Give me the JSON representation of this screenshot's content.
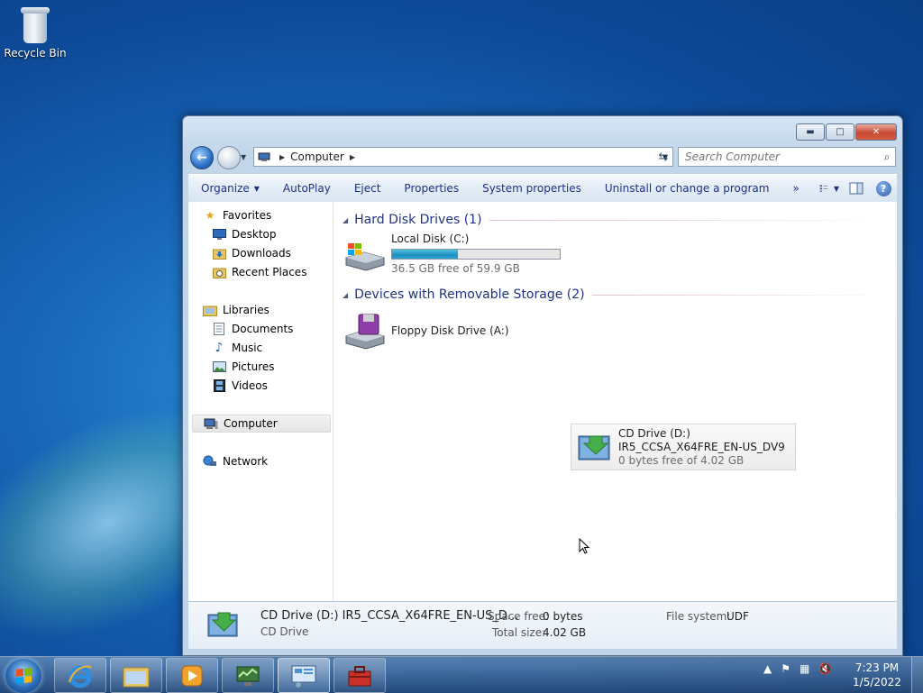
{
  "desktop": {
    "recycle_bin_label": "Recycle Bin"
  },
  "window": {
    "caption_buttons": {
      "minimize": "▬",
      "maximize": "□",
      "close": "✕"
    },
    "address": {
      "crumb": "Computer",
      "separator": "▶"
    },
    "search": {
      "placeholder": "Search Computer"
    },
    "commands": {
      "organize": "Organize",
      "autoplay": "AutoPlay",
      "eject": "Eject",
      "properties": "Properties",
      "system_properties": "System properties",
      "uninstall": "Uninstall or change a program",
      "more": "»"
    },
    "nav": {
      "favorites": "Favorites",
      "desktop": "Desktop",
      "downloads": "Downloads",
      "recent_places": "Recent Places",
      "libraries": "Libraries",
      "documents": "Documents",
      "music": "Music",
      "pictures": "Pictures",
      "videos": "Videos",
      "computer": "Computer",
      "network": "Network"
    },
    "groups": {
      "hdd": "Hard Disk Drives (1)",
      "removable": "Devices with Removable Storage (2)"
    },
    "drives": {
      "local_disk": {
        "name": "Local Disk (C:)",
        "free_text": "36.5 GB free of 59.9 GB",
        "used_fraction": 0.39
      },
      "floppy": {
        "name": "Floppy Disk Drive (A:)"
      },
      "cd": {
        "name": "CD Drive (D:)",
        "label": "IR5_CCSA_X64FRE_EN-US_DV9",
        "free_text": "0 bytes free of 4.02 GB"
      }
    },
    "details": {
      "title": "CD Drive (D:) IR5_CCSA_X64FRE_EN-US_D...",
      "type": "CD Drive",
      "space_free_label": "Space free:",
      "space_free_value": "0 bytes",
      "total_size_label": "Total size:",
      "total_size_value": "4.02 GB",
      "file_system_label": "File system:",
      "file_system_value": "UDF"
    }
  },
  "taskbar": {
    "clock_time": "7:23 PM",
    "clock_date": "1/5/2022"
  },
  "colors": {
    "accent_link": "#1e3287",
    "desktop_blue": "#1866b8",
    "disk_fill": "#1f8fc2"
  }
}
